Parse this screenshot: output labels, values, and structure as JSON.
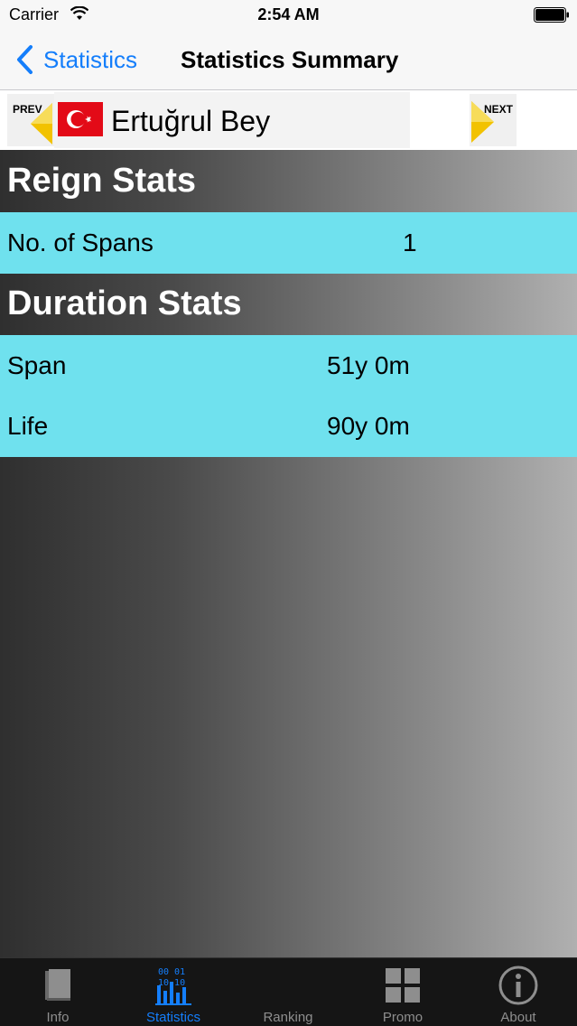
{
  "status_bar": {
    "carrier": "Carrier",
    "time": "2:54 AM"
  },
  "nav": {
    "back_label": "Statistics",
    "title": "Statistics Summary"
  },
  "selector": {
    "prev_label": "PREV",
    "next_label": "NEXT",
    "ruler_name": "Ertuğrul Bey",
    "flag": "turkey-flag-icon"
  },
  "sections": {
    "reign": {
      "title": "Reign Stats",
      "rows": [
        {
          "label": "No. of Spans",
          "value": "1"
        }
      ]
    },
    "duration": {
      "title": "Duration Stats",
      "rows": [
        {
          "label": "Span",
          "value": "51y 0m"
        },
        {
          "label": "Life",
          "value": "90y 0m"
        }
      ]
    }
  },
  "tabs": [
    {
      "label": "Info",
      "icon": "book-icon",
      "active": false
    },
    {
      "label": "Statistics",
      "icon": "statistics-icon",
      "active": true
    },
    {
      "label": "Ranking",
      "icon": "ranking-icon",
      "active": false
    },
    {
      "label": "Promo",
      "icon": "grid-icon",
      "active": false
    },
    {
      "label": "About",
      "icon": "info-icon",
      "active": false
    }
  ],
  "colors": {
    "accent": "#147efb",
    "row_background": "#6fe1ee",
    "tab_bar": "#151515",
    "flag_red": "#e30a17"
  }
}
